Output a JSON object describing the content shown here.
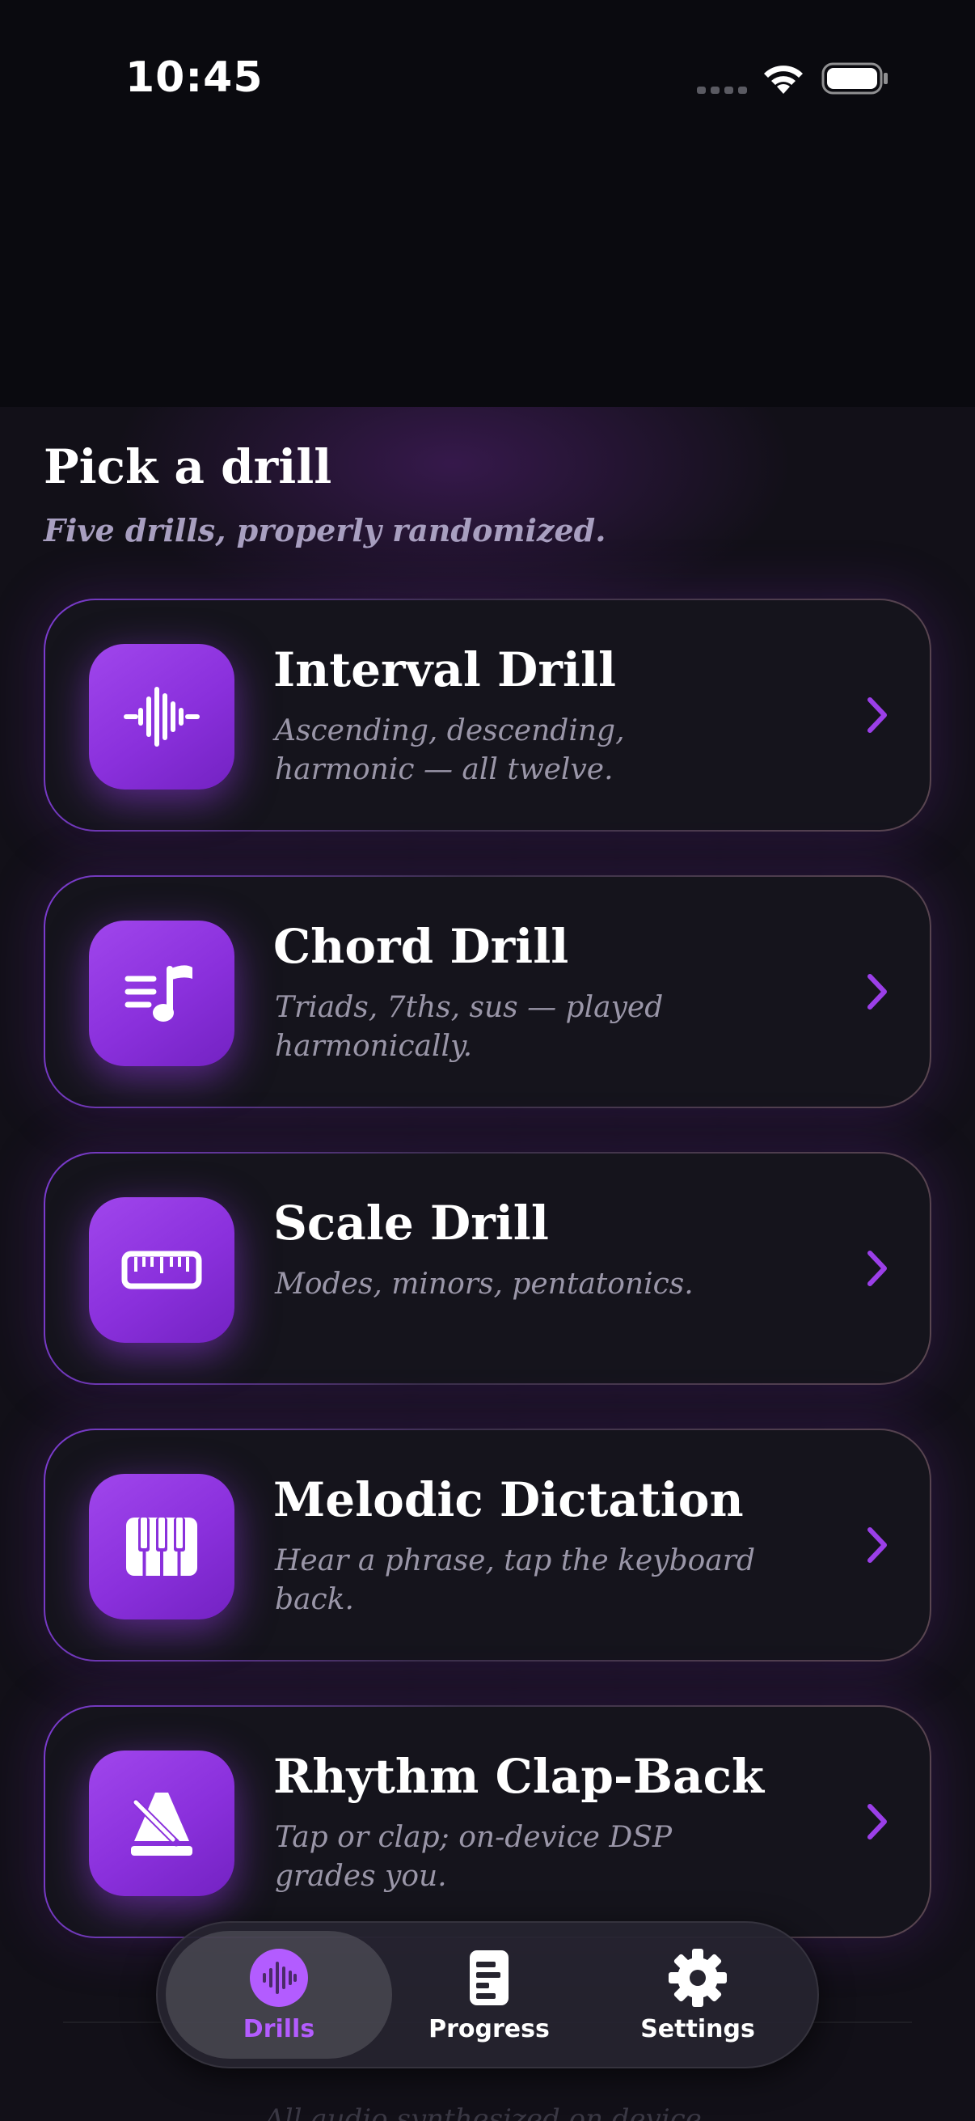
{
  "status_bar": {
    "time": "10:45"
  },
  "header": {
    "title": "Pick a drill",
    "subtitle": "Five drills, properly randomized."
  },
  "drills": [
    {
      "title": "Interval Drill",
      "description": "Ascending, descending, harmonic — all twelve.",
      "icon": "waveform-icon"
    },
    {
      "title": "Chord Drill",
      "description": "Triads, 7ths, sus — played harmonically.",
      "icon": "music-note-list-icon"
    },
    {
      "title": "Scale Drill",
      "description": "Modes, minors, pentatonics.",
      "icon": "ruler-icon"
    },
    {
      "title": "Melodic Dictation",
      "description": "Hear a phrase, tap the keyboard back.",
      "icon": "piano-keys-icon"
    },
    {
      "title": "Rhythm Clap-Back",
      "description": "Tap or clap; on-device DSP grades you.",
      "icon": "metronome-icon"
    }
  ],
  "tab_bar": {
    "tabs": [
      {
        "label": "Drills",
        "icon": "waveform-circle-icon",
        "active": true
      },
      {
        "label": "Progress",
        "icon": "document-chart-icon",
        "active": false
      },
      {
        "label": "Settings",
        "icon": "gear-icon",
        "active": false
      }
    ]
  },
  "footer": {
    "note": "All audio synthesized on device."
  },
  "colors": {
    "accent": "#9b3fe8",
    "active_tab_label": "#b35cff",
    "background": "#0a0a0f",
    "card": "#15141c",
    "description": "#9a96a8"
  }
}
